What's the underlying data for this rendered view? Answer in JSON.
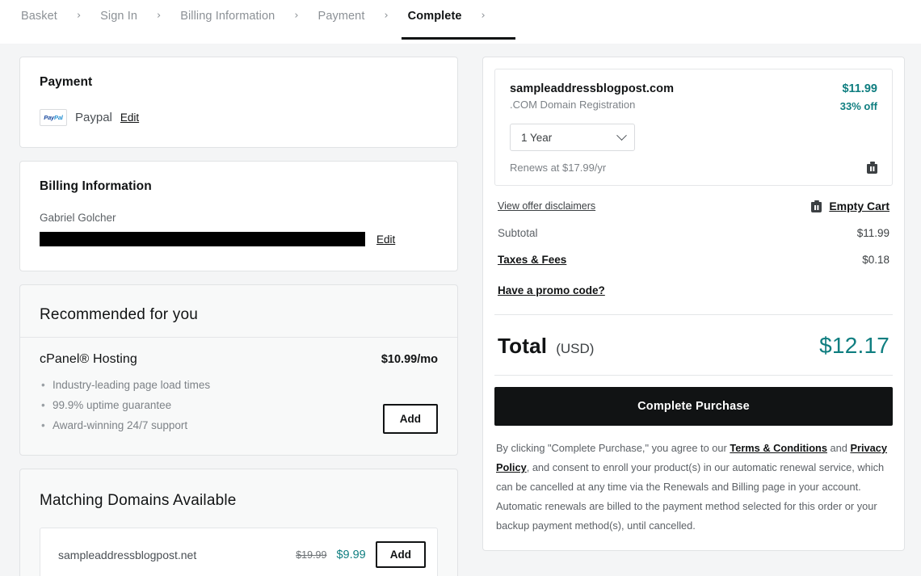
{
  "breadcrumb": {
    "steps": [
      {
        "label": "Basket",
        "active": false
      },
      {
        "label": "Sign In",
        "active": false
      },
      {
        "label": "Billing Information",
        "active": false
      },
      {
        "label": "Payment",
        "active": false
      },
      {
        "label": "Complete",
        "active": true
      }
    ],
    "separator": "›"
  },
  "payment_card": {
    "title": "Payment",
    "logo_text_a": "Pay",
    "logo_text_b": "Pal",
    "method": "Paypal",
    "edit_label": "Edit"
  },
  "billing_card": {
    "title": "Billing Information",
    "name": "Gabriel Golcher",
    "address_redacted": "",
    "edit_label": "Edit"
  },
  "recommended": {
    "heading": "Recommended for you",
    "product": "cPanel® Hosting",
    "price": "$10.99/mo",
    "features": [
      "Industry-leading page load times",
      "99.9% uptime guarantee",
      "Award-winning 24/7 support"
    ],
    "add_label": "Add"
  },
  "matching_domains": {
    "heading": "Matching Domains Available",
    "rows": [
      {
        "name": "sampleaddressblogpost.net",
        "was": "$19.99",
        "now": "$9.99",
        "add_label": "Add"
      }
    ]
  },
  "cart": {
    "item": {
      "domain": "sampleaddressblogpost.com",
      "subtitle": ".COM Domain Registration",
      "price": "$11.99",
      "discount": "33% off",
      "term": "1 Year",
      "renews": "Renews at $17.99/yr"
    },
    "disclaimers_link": "View offer disclaimers",
    "empty_cart_label": "Empty Cart",
    "subtotal_label": "Subtotal",
    "subtotal_value": "$11.99",
    "taxes_label": "Taxes & Fees",
    "taxes_value": "$0.18",
    "promo_label": "Have a promo code?",
    "total_label": "Total",
    "total_currency": "(USD)",
    "total_value": "$12.17",
    "cta_label": "Complete Purchase",
    "legal_1": "By clicking \"Complete Purchase,\" you agree to our ",
    "legal_terms": "Terms & Conditions",
    "legal_2": " and ",
    "legal_privacy": "Privacy Policy",
    "legal_3": ", and consent to enroll your product(s) in our automatic renewal service, which can be cancelled at any time via the Renewals and Billing page in your account. Automatic renewals are billed to the payment method selected for this order or your backup payment method(s), until cancelled."
  },
  "colors": {
    "accent_teal": "#0f7e80",
    "ink": "#111314",
    "muted": "#7d8287",
    "page_bg": "#f4f5f6"
  }
}
